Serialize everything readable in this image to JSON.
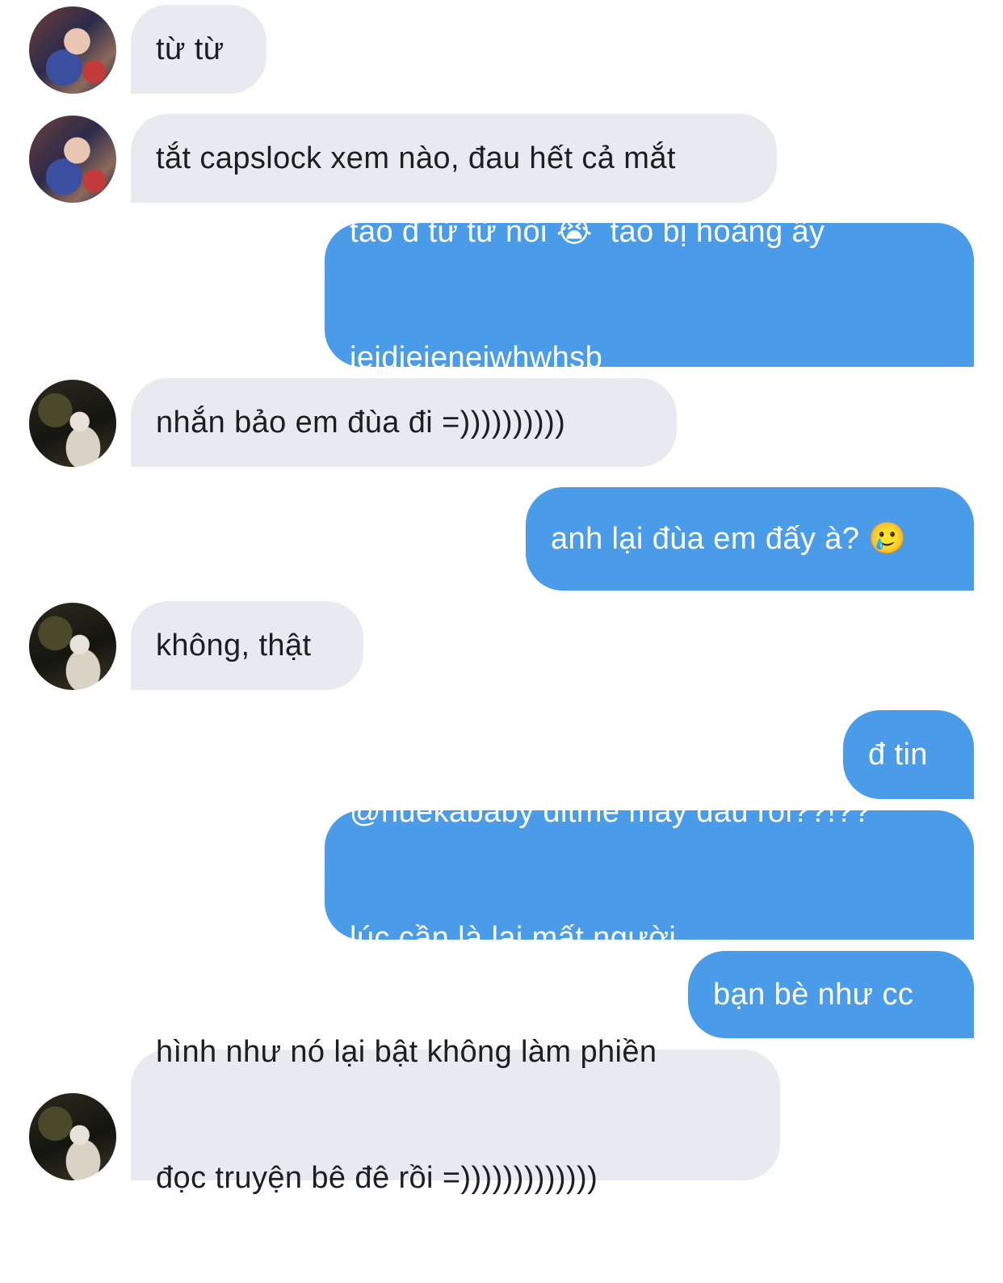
{
  "conversation": {
    "messages": [
      {
        "id": 1,
        "from": "other",
        "text": "từ từ"
      },
      {
        "id": 2,
        "from": "other",
        "text": "tắt capslock xem nào, đau hết cả mắt"
      },
      {
        "id": 3,
        "from": "me",
        "lines": [
          "tao đ từ từ nổi 😭  tao bị hoảng ấy",
          "jeidjeieneiwhwhsb"
        ]
      },
      {
        "id": 4,
        "from": "other",
        "text": "nhắn bảo em đùa đi =))))))))))"
      },
      {
        "id": 5,
        "from": "me",
        "text": "anh lại đùa em đấy à? 🥲"
      },
      {
        "id": 6,
        "from": "other",
        "text": "không, thật"
      },
      {
        "id": 7,
        "from": "me",
        "text": "đ tin"
      },
      {
        "id": 8,
        "from": "me",
        "lines": [
          "@huekababy ditme mày đâu rồi??!??",
          "lúc cần là lại mất người"
        ]
      },
      {
        "id": 9,
        "from": "me",
        "text": "bạn bè như cc"
      },
      {
        "id": 10,
        "from": "other",
        "lines": [
          "hình như nó lại bật không làm phiền",
          "đọc truyện bê đê rồi =)))))))))))))"
        ]
      }
    ]
  },
  "colors": {
    "incoming_bubble": "#e7eaee",
    "outgoing_bubble": "#4a9be8",
    "incoming_text": "#1c1e21",
    "outgoing_text": "#ffffff"
  },
  "icons": {
    "avatar_1": "profile-photo-person-1",
    "avatar_2": "profile-photo-person-2"
  }
}
